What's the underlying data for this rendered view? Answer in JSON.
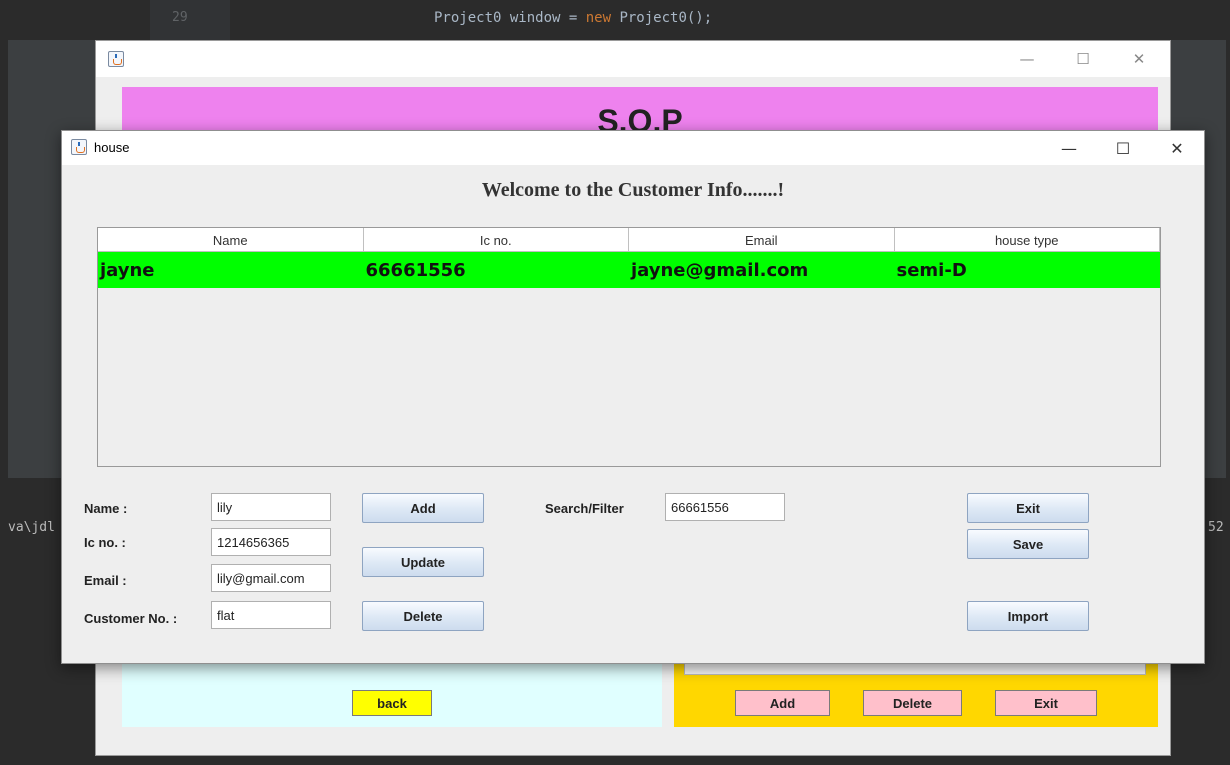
{
  "ide": {
    "line_number": "29",
    "code_prefix": "Project0 window = ",
    "code_keyword": "new",
    "code_suffix": " Project0();",
    "console_left": "va\\jdl",
    "console_right": "52"
  },
  "back_window": {
    "header_title": "S.O.P",
    "controls": {
      "minimize": "—",
      "maximize": "☐",
      "close": "✕"
    },
    "left_buttons": {
      "back": "back"
    },
    "right_buttons": {
      "add": "Add",
      "delete": "Delete",
      "exit": "Exit"
    },
    "colors": {
      "header": "#ee82ee",
      "left_panel": "#e0ffff",
      "right_panel": "#ffd700"
    }
  },
  "front_window": {
    "title": "house",
    "controls": {
      "minimize": "—",
      "maximize": "☐",
      "close": "✕"
    },
    "welcome": "Welcome to the Customer Info.......!",
    "table": {
      "headers": [
        "Name",
        "Ic no.",
        "Email",
        "house type"
      ],
      "rows": [
        [
          "jayne",
          "66661556",
          "jayne@gmail.com",
          "semi-D"
        ]
      ],
      "selected_row_color": "#00ff00"
    },
    "form": {
      "name_label": "Name :",
      "name_value": "lily",
      "ic_label": "Ic no. :",
      "ic_value": "1214656365",
      "email_label": "Email :",
      "email_value": "lily@gmail.com",
      "customer_label": "Customer No. :",
      "customer_value": "flat",
      "search_label": "Search/Filter",
      "search_value": "66661556"
    },
    "buttons": {
      "add": "Add",
      "update": "Update",
      "delete": "Delete",
      "exit": "Exit",
      "save": "Save",
      "import": "Import"
    }
  }
}
